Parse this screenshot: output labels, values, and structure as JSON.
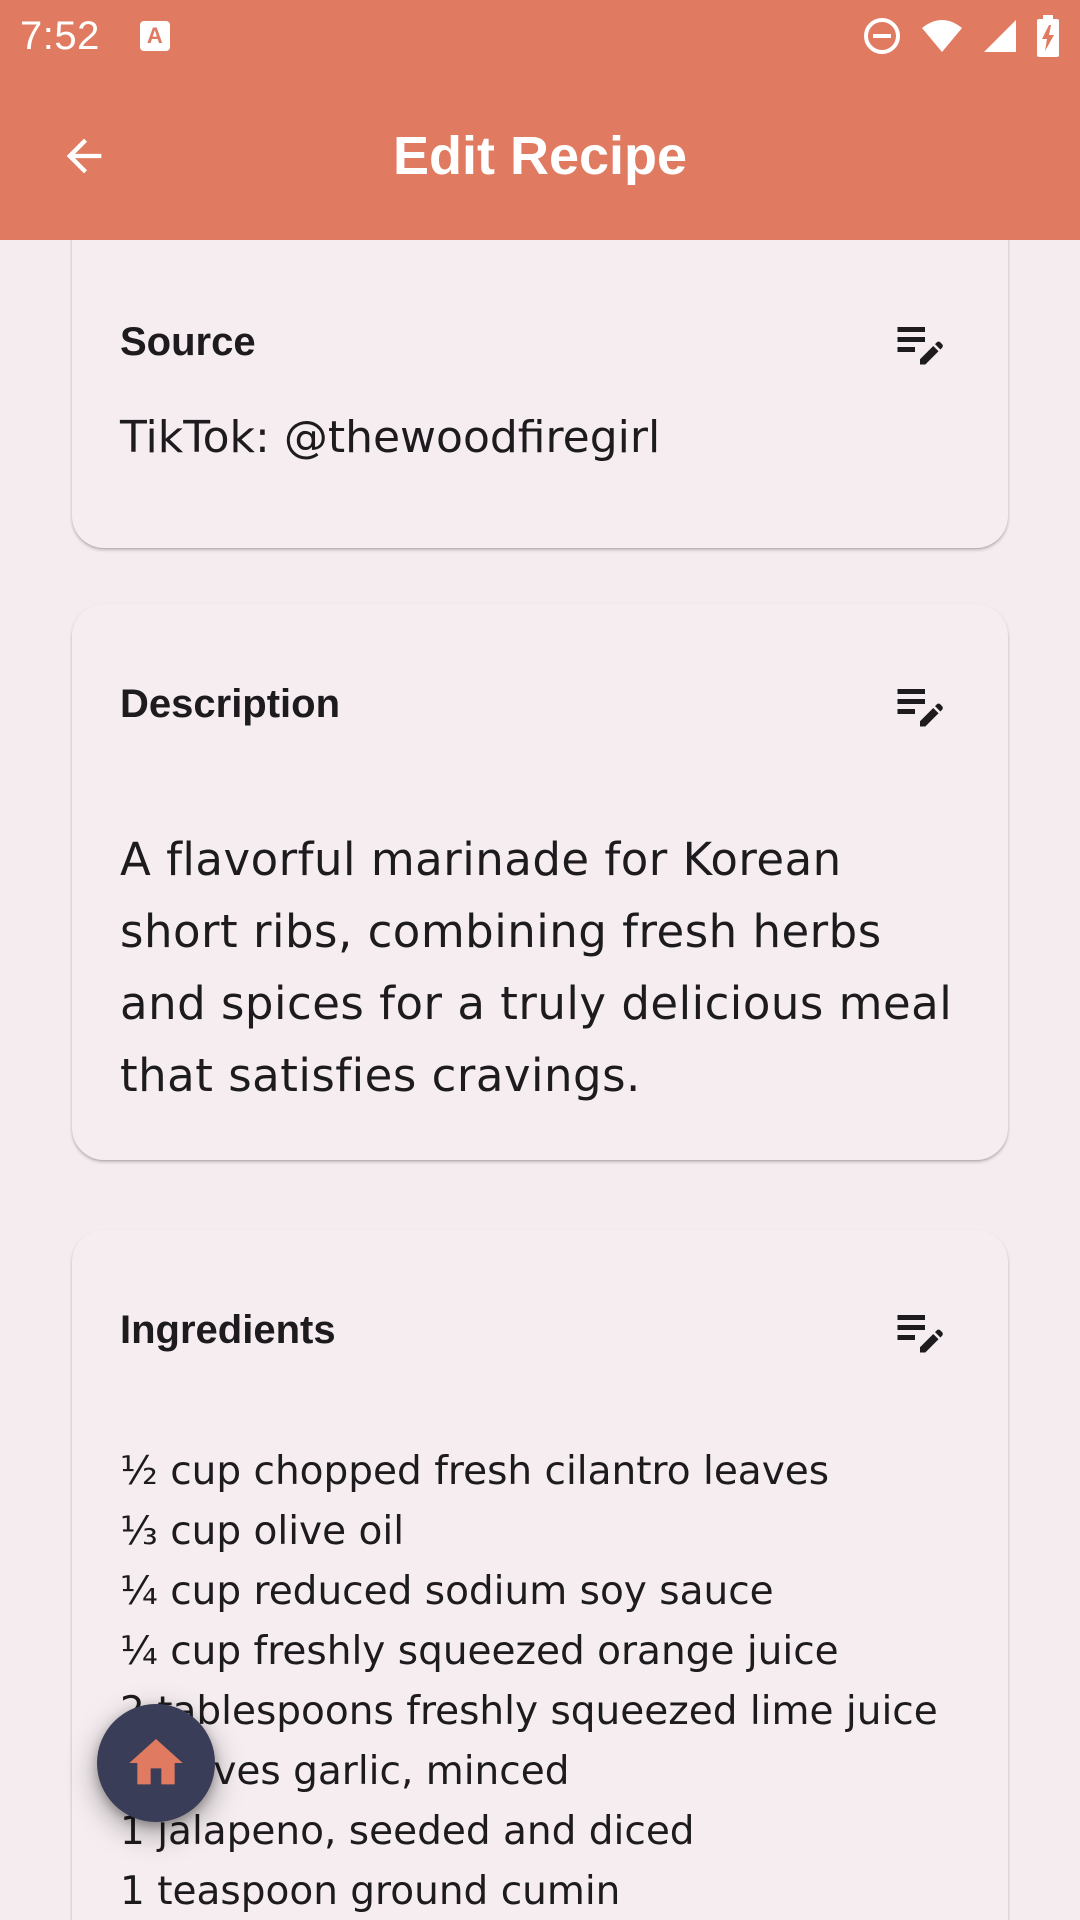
{
  "status_bar": {
    "time": "7:52",
    "notification_icon": "a-icon",
    "icons": [
      "do-not-disturb-icon",
      "wifi-icon",
      "signal-icon",
      "battery-charging-icon"
    ]
  },
  "app_bar": {
    "title": "Edit Recipe",
    "back_icon": "arrow-back-icon",
    "background_color": "#e07b61"
  },
  "cards": {
    "source": {
      "title": "Source",
      "value": "TikTok: @thewoodfiregirl",
      "edit_icon": "edit-note-icon"
    },
    "description": {
      "title": "Description",
      "value": "A flavorful marinade for Korean short ribs, combining fresh herbs and spices for a truly delicious meal that satisfies cravings.",
      "edit_icon": "edit-note-icon"
    },
    "ingredients": {
      "title": "Ingredients",
      "edit_icon": "edit-note-icon",
      "items": [
        "½ cup chopped fresh cilantro leaves",
        "⅓ cup olive oil",
        "¼ cup reduced sodium soy sauce",
        "¼ cup freshly squeezed orange juice",
        "2 tablespoons freshly squeezed lime juice",
        "4 cloves garlic, minced",
        "1 jalapeno, seeded and diced",
        "1 teaspoon ground cumin"
      ]
    }
  },
  "fab": {
    "icon": "home-icon",
    "background_color": "#3a3d58",
    "icon_color": "#e07b61"
  }
}
